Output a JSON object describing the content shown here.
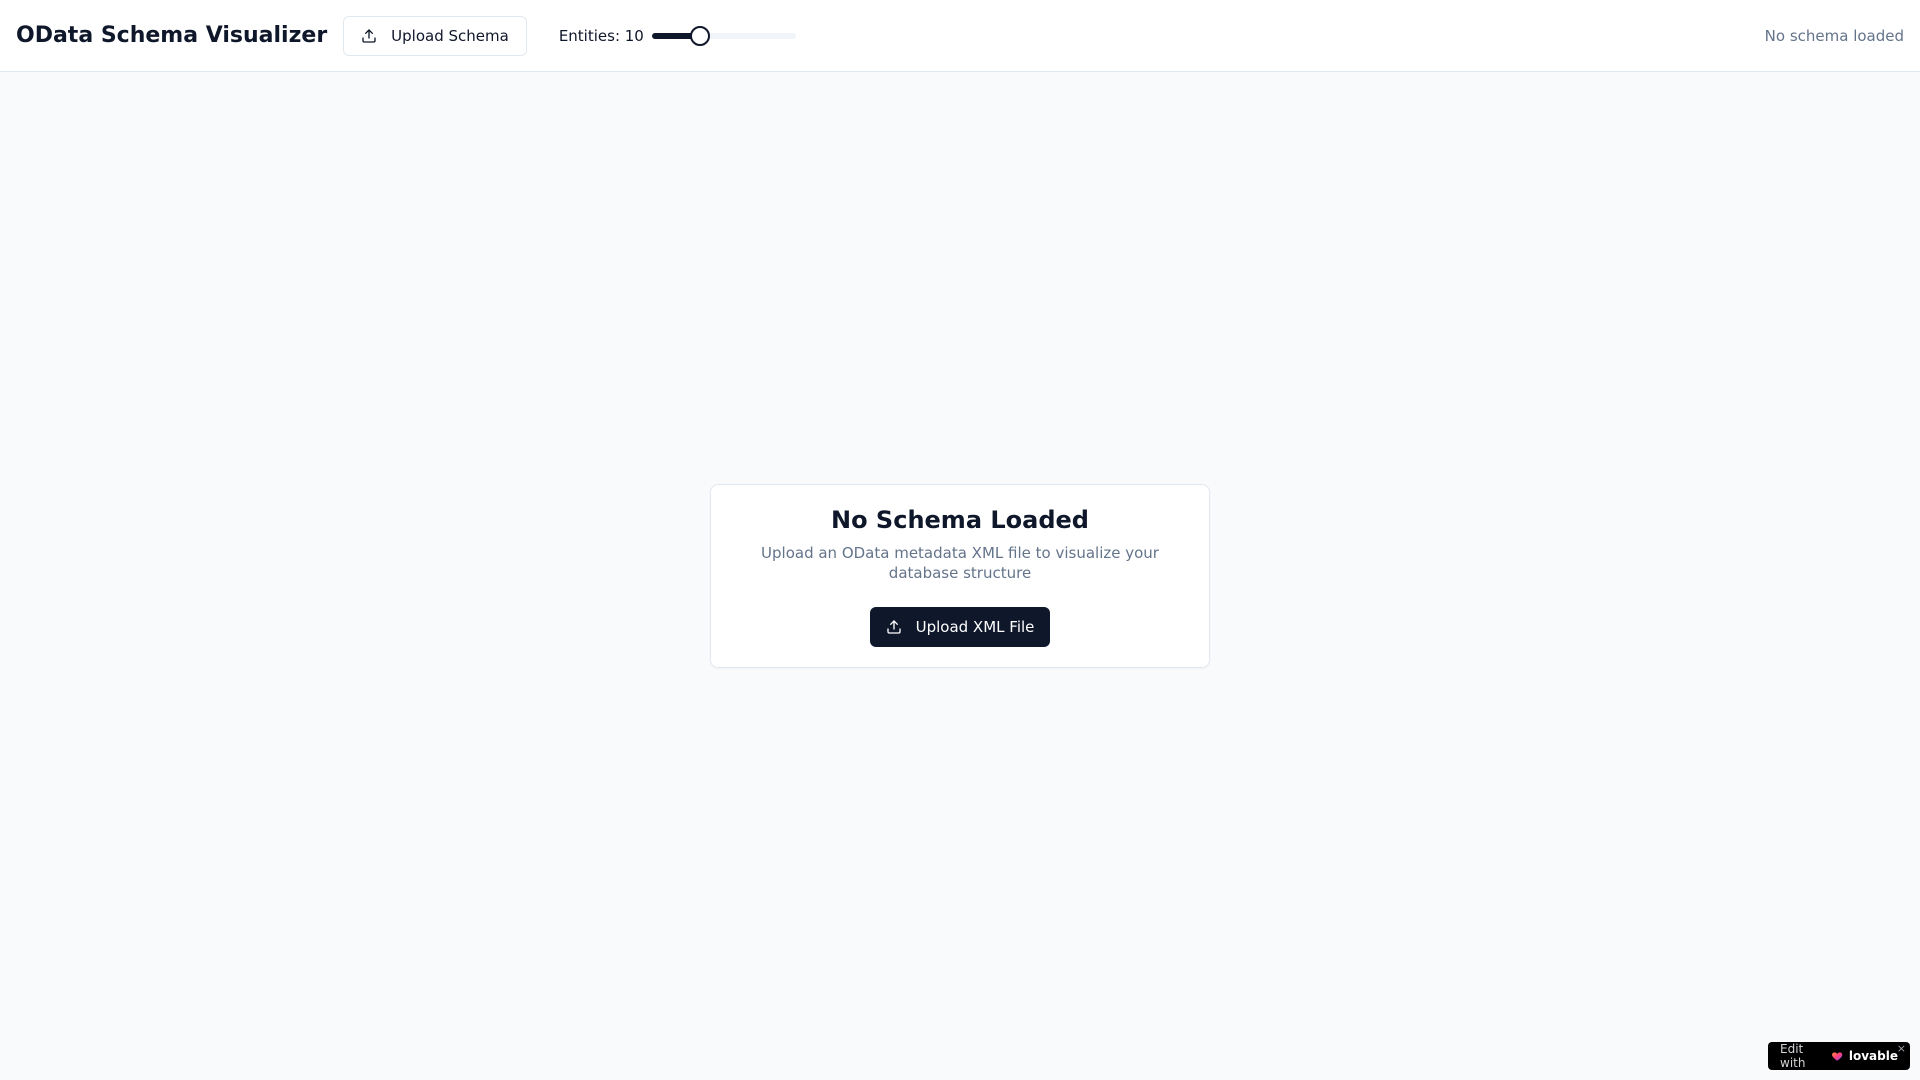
{
  "header": {
    "title": "OData Schema Visualizer",
    "upload_button_label": "Upload Schema",
    "entities_label": "Entities: 10",
    "entities_slider_fraction": 0.33,
    "status_text": "No schema loaded"
  },
  "empty_state": {
    "title": "No Schema Loaded",
    "description": "Upload an OData metadata XML file to visualize your database structure",
    "button_label": "Upload XML File"
  },
  "badge": {
    "prefix": "Edit with",
    "brand": "lovable",
    "close": "×"
  },
  "icons": {
    "upload": "upload-icon",
    "heart": "lovable-heart-icon",
    "close": "close-icon"
  },
  "colors": {
    "primary": "#0f172a",
    "muted_text": "#64748b",
    "border": "#e2e8f0",
    "background": "#f8fafc"
  }
}
